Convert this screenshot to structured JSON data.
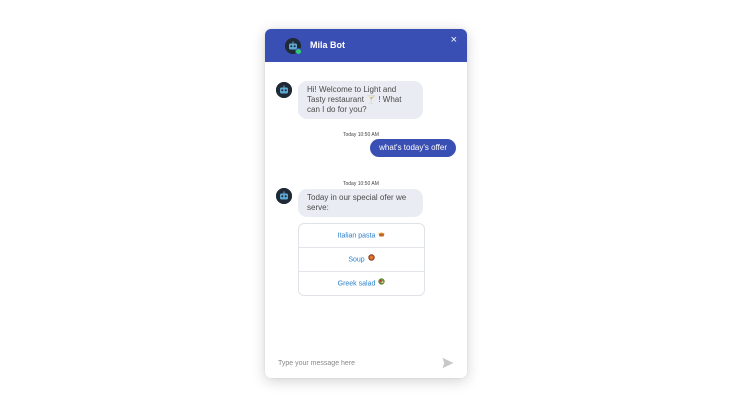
{
  "header": {
    "bot_name": "Mila Bot",
    "close_glyph": "×"
  },
  "messages": [
    {
      "sender": "bot",
      "text": "Hi! Welcome to Light and Tasty restaurant 🍸 ! What can I do for you?"
    },
    {
      "sender": "user",
      "time": "Today 10:50 AM",
      "text": "what's today's offer"
    },
    {
      "sender": "bot",
      "time": "Today 10:50 AM",
      "text": "Today in our special ofer we serve:"
    }
  ],
  "options": [
    {
      "label": "Italian pasta",
      "icon": "pasta-icon"
    },
    {
      "label": "Soup",
      "icon": "soup-icon"
    },
    {
      "label": "Greek salad",
      "icon": "salad-icon"
    }
  ],
  "composer": {
    "placeholder": "Type your message here",
    "send_icon": "send-icon"
  },
  "colors": {
    "accent": "#3a4fb3",
    "bot_bubble": "#e9edf3",
    "option_text": "#2a7fc8",
    "online": "#2ecc71"
  }
}
